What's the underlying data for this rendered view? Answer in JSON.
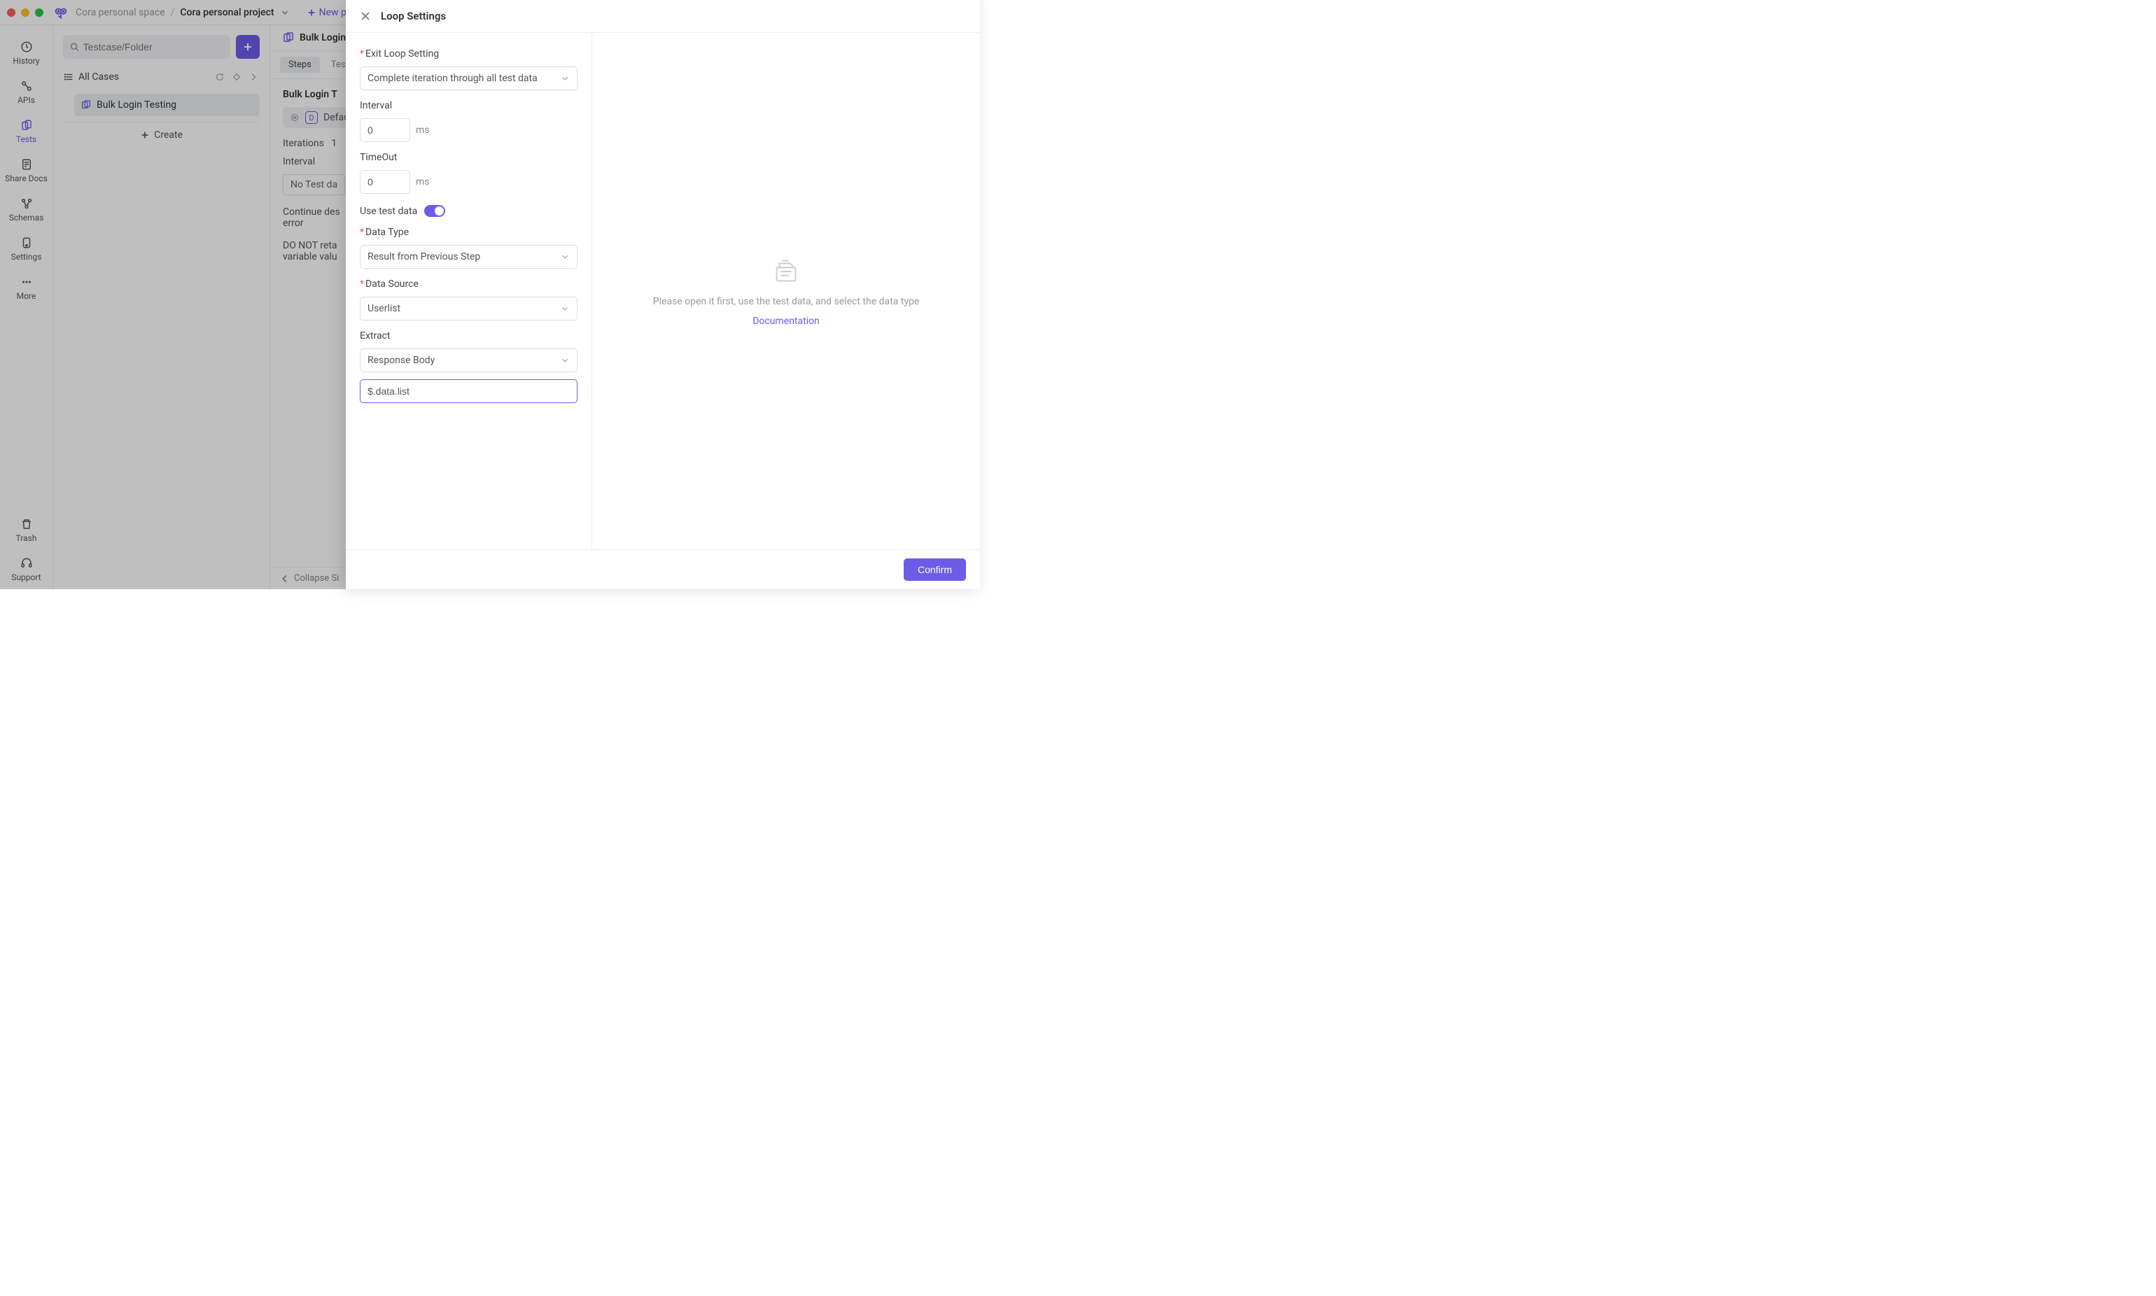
{
  "title": {
    "breadcrumb_parent": "Cora personal space",
    "breadcrumb_current": "Cora personal project",
    "new_project": "New project"
  },
  "rail": {
    "history": "History",
    "apis": "APIs",
    "tests": "Tests",
    "share_docs": "Share Docs",
    "schemas": "Schemas",
    "settings": "Settings",
    "more": "More",
    "trash": "Trash",
    "support": "Support"
  },
  "sidebar": {
    "search_placeholder": "Testcase/Folder",
    "all_cases": "All Cases",
    "item": "Bulk Login Testing",
    "create": "Create"
  },
  "main": {
    "tab_label": "Bulk Login T",
    "subtab_steps": "Steps",
    "subtab_test": "Test D",
    "section_title": "Bulk Login T",
    "default": "Defaul",
    "iterations_label": "Iterations",
    "iterations_value": "1",
    "interval_label": "Interval",
    "no_test_data": "No Test da",
    "continue_line": "Continue des",
    "error_line": "error",
    "retain_line1": "DO NOT reta",
    "retain_line2": "variable valu",
    "collapse": "Collapse Si"
  },
  "panel": {
    "title": "Loop Settings",
    "exit_loop_label": "Exit Loop Setting",
    "exit_loop_value": "Complete iteration through all test data",
    "interval_label": "Interval",
    "interval_value": "0",
    "interval_unit": "ms",
    "timeout_label": "TimeOut",
    "timeout_value": "0",
    "timeout_unit": "ms",
    "use_test_data": "Use test data",
    "data_type_label": "Data Type",
    "data_type_value": "Result from Previous Step",
    "data_source_label": "Data Source",
    "data_source_value": "Userlist",
    "extract_label": "Extract",
    "extract_value": "Response Body",
    "path_value": "$.data.list",
    "hint": "Please open it first, use the test data, and select the data type",
    "doc_link": "Documentation",
    "confirm": "Confirm"
  }
}
